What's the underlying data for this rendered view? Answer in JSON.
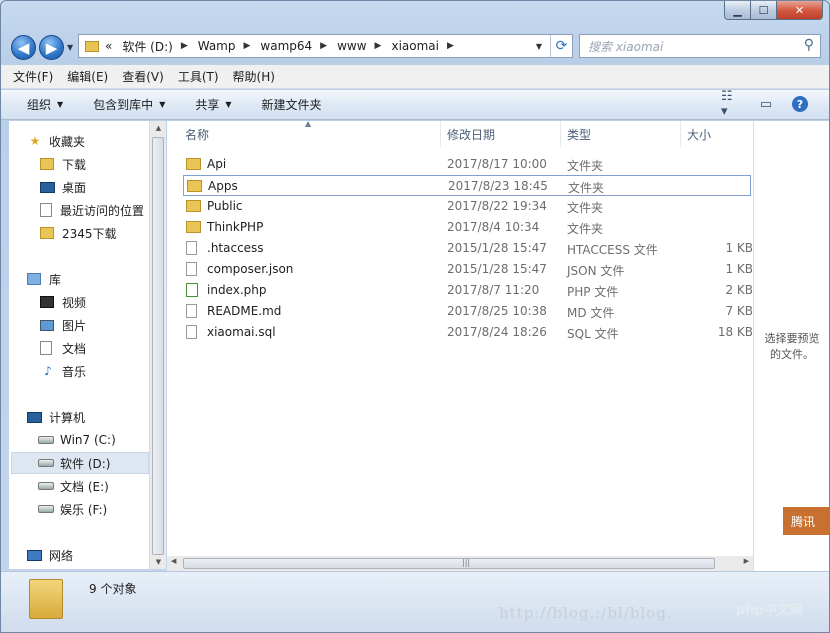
{
  "window": {
    "caption_buttons": {
      "minimize": "▁",
      "maximize": "☐",
      "close": "✕"
    }
  },
  "address_bar": {
    "prefix": "«",
    "crumbs": [
      "软件 (D:)",
      "Wamp",
      "wamp64",
      "www",
      "xiaomai"
    ],
    "separator": "▶"
  },
  "search": {
    "placeholder": "搜索 xiaomai"
  },
  "menu": [
    "文件(F)",
    "编辑(E)",
    "查看(V)",
    "工具(T)",
    "帮助(H)"
  ],
  "commands": {
    "organize": "组织",
    "include_library": "包含到库中",
    "share": "共享",
    "new_folder": "新建文件夹"
  },
  "nav": {
    "favorites": {
      "label": "收藏夹",
      "items": [
        "下载",
        "桌面",
        "最近访问的位置",
        "2345下载"
      ]
    },
    "libraries": {
      "label": "库",
      "items": [
        "视频",
        "图片",
        "文档",
        "音乐"
      ]
    },
    "computer": {
      "label": "计算机",
      "items": [
        "Win7 (C:)",
        "软件 (D:)",
        "文档 (E:)",
        "娱乐 (F:)"
      ]
    },
    "network": {
      "label": "网络"
    }
  },
  "columns": {
    "name": "名称",
    "date": "修改日期",
    "type": "类型",
    "size": "大小"
  },
  "files": [
    {
      "name": "Api",
      "date": "2017/8/17 10:00",
      "type": "文件夹",
      "size": "",
      "icon": "folder-icon"
    },
    {
      "name": "Apps",
      "date": "2017/8/23 18:45",
      "type": "文件夹",
      "size": "",
      "icon": "folder-icon"
    },
    {
      "name": "Public",
      "date": "2017/8/22 19:34",
      "type": "文件夹",
      "size": "",
      "icon": "folder-icon"
    },
    {
      "name": "ThinkPHP",
      "date": "2017/8/4 10:34",
      "type": "文件夹",
      "size": "",
      "icon": "folder-icon"
    },
    {
      "name": ".htaccess",
      "date": "2015/1/28 15:47",
      "type": "HTACCESS 文件",
      "size": "1 KB",
      "icon": "file-icon"
    },
    {
      "name": "composer.json",
      "date": "2015/1/28 15:47",
      "type": "JSON 文件",
      "size": "1 KB",
      "icon": "file-icon"
    },
    {
      "name": "index.php",
      "date": "2017/8/7 11:20",
      "type": "PHP 文件",
      "size": "2 KB",
      "icon": "php-file-icon"
    },
    {
      "name": "README.md",
      "date": "2017/8/25 10:38",
      "type": "MD 文件",
      "size": "7 KB",
      "icon": "file-icon"
    },
    {
      "name": "xiaomai.sql",
      "date": "2017/8/24 18:26",
      "type": "SQL 文件",
      "size": "18 KB",
      "icon": "file-icon"
    }
  ],
  "preview": {
    "text_line1": "选择要预览",
    "text_line2": "的文件。"
  },
  "status": {
    "count": "9 个对象"
  },
  "overlay": {
    "watermark": "http://blog.:/bl/blog.",
    "badge": "php中文网",
    "side_tab": "腾讯"
  }
}
